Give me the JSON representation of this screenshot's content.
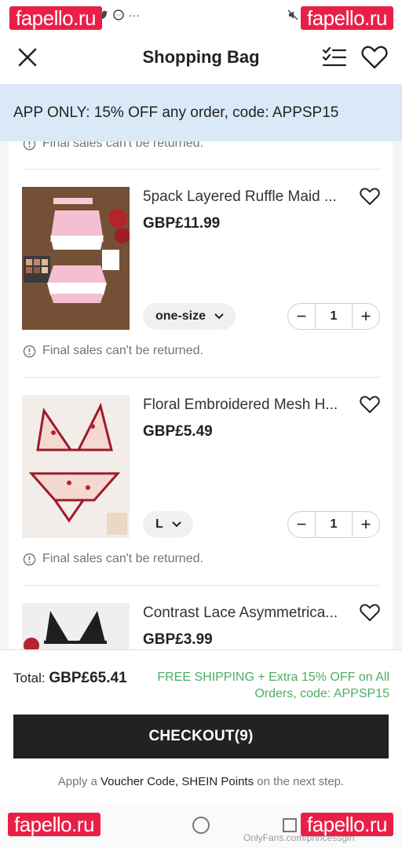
{
  "watermarks": [
    "fapello.ru",
    "fapello.ru",
    "fapello.ru",
    "fapello.ru"
  ],
  "watermark_text_bottom": "OnlyFans.com/princessgirl",
  "header": {
    "title": "Shopping Bag"
  },
  "banner": {
    "text": "APP ONLY: 15% OFF any order, code: APPSP15"
  },
  "final_sale_note": "Final sales can't be returned.",
  "items": [
    {
      "name": "5pack Layered Ruffle Maid ...",
      "price": "GBP£11.99",
      "size": "one-size",
      "qty": "1"
    },
    {
      "name": "Floral Embroidered Mesh H...",
      "price": "GBP£5.49",
      "size": "L",
      "qty": "1"
    },
    {
      "name": "Contrast Lace Asymmetrica...",
      "price": "GBP£3.99",
      "size": "",
      "qty": ""
    }
  ],
  "summary": {
    "total_label": "Total:",
    "total_value": "GBP£65.41",
    "promo": "FREE SHIPPING + Extra 15% OFF on All Orders, code: APPSP15",
    "checkout_label": "CHECKOUT(9)",
    "voucher_prefix": "Apply a ",
    "voucher_highlight": "Voucher Code, SHEIN Points",
    "voucher_suffix": " on the next step."
  },
  "colors": {
    "accent_green": "#4cae63",
    "banner_bg": "#dbe8f8",
    "checkout_bg": "#222222",
    "watermark_red": "#ea1f47"
  }
}
